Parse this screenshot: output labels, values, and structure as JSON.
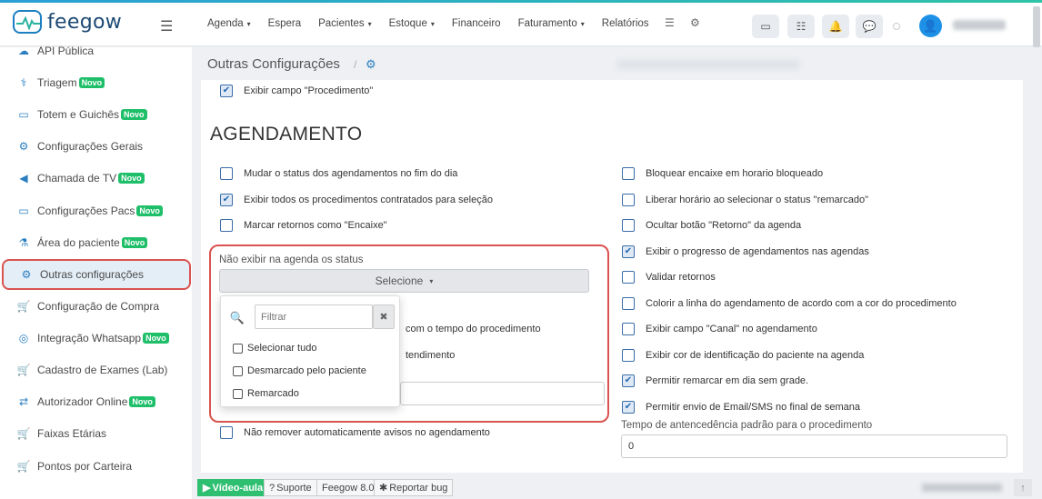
{
  "app": {
    "logo_text": "feegow"
  },
  "nav": {
    "items": [
      {
        "label": "Agenda",
        "dropdown": true
      },
      {
        "label": "Espera",
        "dropdown": false
      },
      {
        "label": "Pacientes",
        "dropdown": true
      },
      {
        "label": "Estoque",
        "dropdown": true
      },
      {
        "label": "Financeiro",
        "dropdown": false
      },
      {
        "label": "Faturamento",
        "dropdown": true
      },
      {
        "label": "Relatórios",
        "dropdown": false
      }
    ],
    "caret": "▾",
    "hamburger": "☰"
  },
  "sidebar": {
    "badge": "Novo",
    "items": [
      {
        "label": "API Pública",
        "icon": "cloud-icon",
        "glyph": "☁",
        "badge": false
      },
      {
        "label": "Triagem",
        "icon": "stethoscope-icon",
        "glyph": "⚕",
        "badge": true
      },
      {
        "label": "Totem e Guichês",
        "icon": "laptop-icon",
        "glyph": "▭",
        "badge": true
      },
      {
        "label": "Configurações Gerais",
        "icon": "gears-icon",
        "glyph": "⚙",
        "badge": false
      },
      {
        "label": "Chamada de TV",
        "icon": "megaphone-icon",
        "glyph": "◀",
        "badge": true
      },
      {
        "label": "Configurações Pacs",
        "icon": "laptop-icon",
        "glyph": "▭",
        "badge": true
      },
      {
        "label": "Área do paciente",
        "icon": "flask-icon",
        "glyph": "⚗",
        "badge": true
      },
      {
        "label": "Outras configurações",
        "icon": "gears-icon",
        "glyph": "⚙",
        "badge": false,
        "active": true
      },
      {
        "label": "Configuração de Compra",
        "icon": "cart-icon",
        "glyph": "🛒",
        "badge": false
      },
      {
        "label": "Integração Whatsapp",
        "icon": "whatsapp-icon",
        "glyph": "◎",
        "badge": true
      },
      {
        "label": "Cadastro de Exames (Lab)",
        "icon": "cart-icon",
        "glyph": "🛒",
        "badge": false
      },
      {
        "label": "Autorizador Online",
        "icon": "exchange-icon",
        "glyph": "⇄",
        "badge": true
      },
      {
        "label": "Faixas Etárias",
        "icon": "cart-icon",
        "glyph": "🛒",
        "badge": false
      },
      {
        "label": "Pontos por Carteira",
        "icon": "cart-icon",
        "glyph": "🛒",
        "badge": false
      }
    ]
  },
  "page": {
    "title": "Outras Configurações",
    "separator": "/"
  },
  "settings": {
    "top_option": {
      "label": "Exibir campo \"Procedimento\"",
      "checked": true
    },
    "section_title": "AGENDAMENTO",
    "left": [
      {
        "label": "Mudar o status dos agendamentos no fim do dia",
        "checked": false
      },
      {
        "label": "Exibir todos os procedimentos contratados para seleção",
        "checked": true
      },
      {
        "label": "Marcar retornos como \"Encaixe\"",
        "checked": false
      }
    ],
    "right": [
      {
        "label": "Bloquear encaixe em horario bloqueado",
        "checked": false
      },
      {
        "label": "Liberar horário ao selecionar o status \"remarcado\"",
        "checked": false
      },
      {
        "label": "Ocultar botão \"Retorno\" da agenda",
        "checked": false
      },
      {
        "label": "Exibir o progresso de agendamentos nas agendas",
        "checked": true
      },
      {
        "label": "Validar retornos",
        "checked": false
      },
      {
        "label": "Colorir a linha do agendamento de acordo com a cor do procedimento",
        "checked": false
      },
      {
        "label": "Exibir campo \"Canal\" no agendamento",
        "checked": false
      },
      {
        "label": "Exibir cor de identificação do paciente na agenda",
        "checked": false
      },
      {
        "label": "Permitir remarcar em dia sem grade.",
        "checked": true
      },
      {
        "label": "Permitir envio de Email/SMS no final de semana",
        "checked": true
      }
    ],
    "status_filter": {
      "label": "Não exibir na agenda os status",
      "button_label": "Selecione",
      "caret": "▾",
      "filter_placeholder": "Filtrar",
      "clear_glyph": "✖",
      "options": [
        "Selecionar tudo",
        "Desmarcado pelo paciente",
        "Remarcado"
      ]
    },
    "hidden_partial": [
      "com o tempo do procedimento",
      "tendimento"
    ],
    "bottom_left": {
      "label": "Não remover automaticamente avisos no agendamento",
      "checked": false
    },
    "advance_time": {
      "label": "Tempo de antencedência padrão para o procedimento",
      "value": "0"
    }
  },
  "footer": {
    "video": "Vídeo-aula",
    "support": "Suporte",
    "version": "Feegow 8.0",
    "bug": "Reportar bug",
    "up": "↑"
  }
}
